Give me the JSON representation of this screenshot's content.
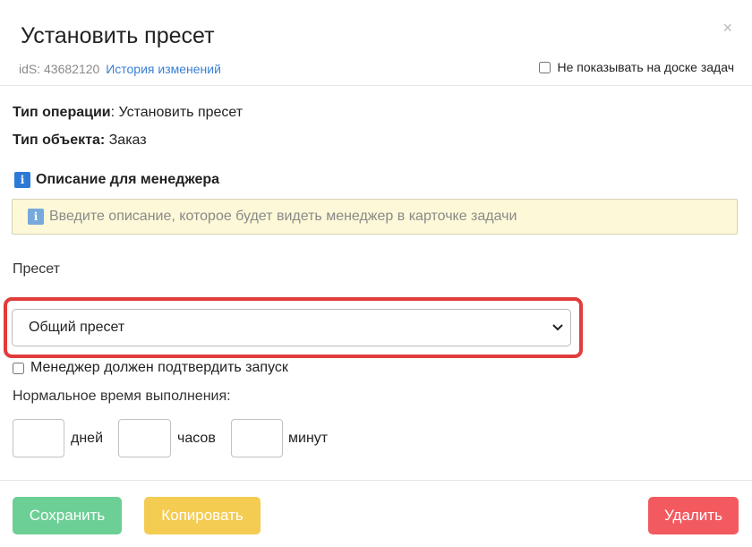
{
  "header": {
    "title": "Установить пресет",
    "close_glyph": "×",
    "ids_label": "idS:",
    "ids_value": "43682120",
    "history_link": "История изменений",
    "hide_board_label": "Не показывать на доске задач"
  },
  "info": {
    "op_type_label": "Тип операции",
    "op_type_value": ": Установить пресет",
    "obj_type_label": "Тип объекта:",
    "obj_type_value": " Заказ"
  },
  "description": {
    "icon": "info-icon",
    "badge_glyph": "i",
    "heading": "Описание для менеджера",
    "placeholder": "Введите описание, которое будет видеть менеджер в карточке задачи"
  },
  "preset": {
    "label": "Пресет",
    "selected": "Общий пресет",
    "chevron": "⌄"
  },
  "confirm_label": "Менеджер должен подтвердить запуск",
  "normal_time": {
    "label": "Нормальное время выполнения:",
    "days_label": "дней",
    "hours_label": "часов",
    "minutes_label": "минут"
  },
  "buttons": {
    "save": "Сохранить",
    "copy": "Копировать",
    "delete": "Удалить"
  },
  "colors": {
    "save": "#6ccf95",
    "copy": "#f4cc52",
    "delete": "#f25a5f",
    "highlight": "#e23c3c",
    "link": "#3a7fd5"
  }
}
